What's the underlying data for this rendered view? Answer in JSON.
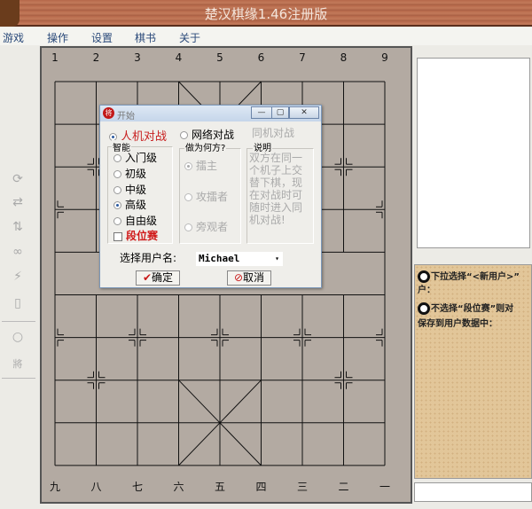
{
  "window": {
    "title": "楚汉棋缘1.46注册版"
  },
  "menu": [
    "游戏",
    "操作",
    "设置",
    "棋书",
    "关于"
  ],
  "tools": [
    "swap-icon",
    "exchange-icon",
    "updown-icon",
    "link-icon",
    "lightning-icon",
    "book-icon",
    "circle-icon",
    "general-icon"
  ],
  "tool_glyphs": [
    "⟳",
    "⇄",
    "⇅",
    "∞",
    "⚡",
    "▯",
    "○",
    "將"
  ],
  "board": {
    "top_labels": [
      "1",
      "2",
      "3",
      "4",
      "5",
      "6",
      "7",
      "8",
      "9"
    ],
    "bottom_labels": [
      "九",
      "八",
      "七",
      "六",
      "五",
      "四",
      "三",
      "二",
      "一"
    ]
  },
  "panel": {
    "msg1a": "下拉选择“<新用户>”",
    "msg1b": "户：",
    "msg2a": "不选择“段位赛”则对",
    "msg2b": "保存到用户数据中："
  },
  "dialog": {
    "icon": "将",
    "title": "开始",
    "modes": {
      "ai": "人机对战",
      "net": "网络对战",
      "local": "同机对战"
    },
    "level_group": "智能",
    "levels": [
      "入门级",
      "初级",
      "中级",
      "高级",
      "自由级"
    ],
    "selected_level": "高级",
    "ranked": "段位赛",
    "side_group": "做为何方?",
    "sides": [
      "擂主",
      "攻擂者",
      "旁观者"
    ],
    "desc_group": "说明",
    "desc": "双方在同一个机子上交替下棋，现在对战时可随时进入同机对战!",
    "user_label": "选择用户名:",
    "user_value": "Michael",
    "ok": "确定",
    "cancel": "取消",
    "minimize": "—",
    "maximize": "▢",
    "close": "✕"
  }
}
